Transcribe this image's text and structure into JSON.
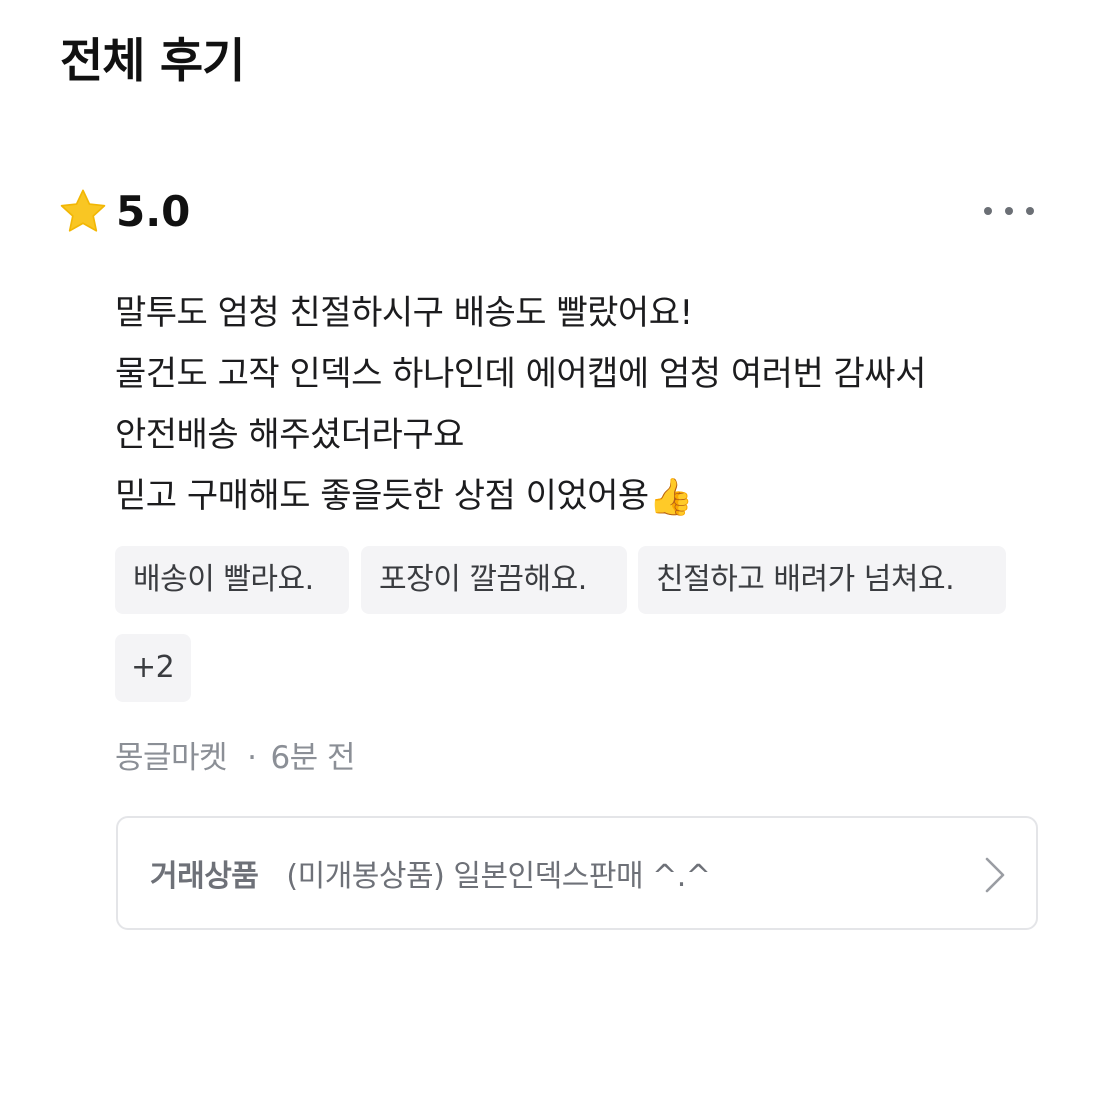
{
  "header": {
    "title": "전체 후기"
  },
  "review": {
    "rating": "5.0",
    "star_icon": "star-icon",
    "star_color": "#F9C623",
    "more_icon": "more-horizontal-icon",
    "lines": [
      "말투도 엄청 친절하시구 배송도 빨랐어요!",
      "물건도 고작 인덱스 하나인데 에어캡에 엄청 여러번 감싸서",
      "안전배송 해주셨더라구요",
      "믿고 구매해도 좋을듯한 상점 이었어용"
    ],
    "emoji": "👍",
    "tags": [
      "배송이 빨라요.",
      "포장이 깔끔해요.",
      "친절하고 배려가 넘쳐요.",
      "+2"
    ],
    "reviewer": "몽글마켓",
    "separator": "·",
    "time_ago": "6분 전"
  },
  "product": {
    "label": "거래상품",
    "name": "(미개봉상품) 일본인덱스판매 ^.^",
    "chevron_icon": "chevron-right-icon"
  }
}
